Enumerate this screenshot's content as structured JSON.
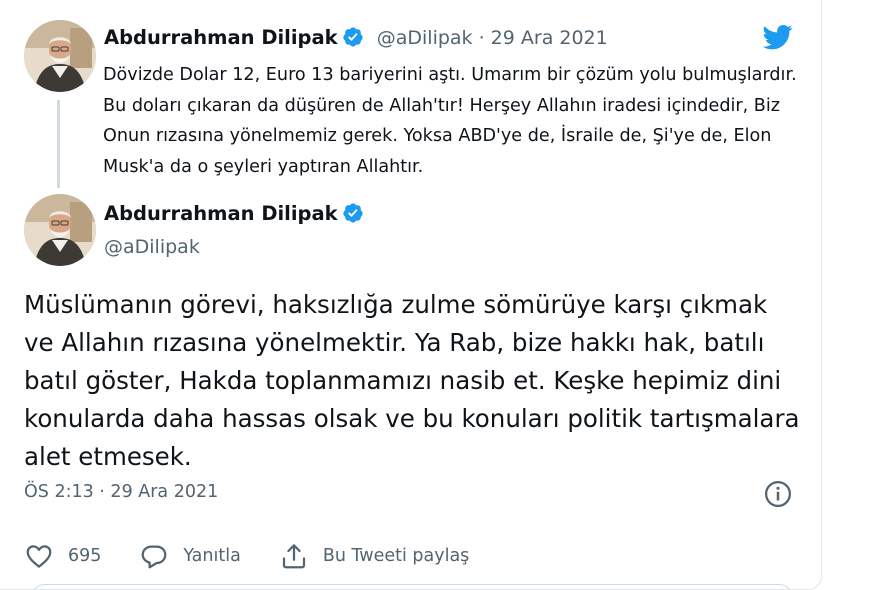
{
  "quoted_tweet": {
    "author_name": "Abdurrahman Dilipak",
    "handle_date": "@aDilipak · 29 Ara 2021",
    "text": "Dövizde Dolar 12, Euro 13 bariyerini aştı. Umarım bir çözüm yolu bulmuşlardır. Bu doları çıkaran da düşüren de Allah'tır! Herşey Allahın iradesi içindedir, Biz Onun rızasına yönelmemiz gerek. Yoksa ABD'ye de, İsraile de, Şi'ye de, Elon Musk'a da o şeyleri yaptıran Allahtır."
  },
  "main_tweet": {
    "author_name": "Abdurrahman Dilipak",
    "handle": "@aDilipak",
    "text": "Müslümanın görevi, haksızlığa zulme sömürüye karşı çıkmak ve Allahın rızasına yönelmektir. Ya Rab, bize hakkı hak, batılı batıl göster, Hakda toplanmamızı nasib et. Keşke hepimiz dini konularda daha hassas olsak ve bu konuları politik tartışmalara alet etmesek.",
    "timestamp": "ÖS 2:13 · 29 Ara 2021"
  },
  "actions": {
    "like_count": "695",
    "reply_label": "Yanıtla",
    "share_label": "Bu Tweeti paylaş"
  },
  "icons": {
    "logo": "twitter-bird-icon",
    "verified": "verified-badge-icon",
    "info": "info-icon",
    "like": "heart-icon",
    "reply": "reply-bubble-icon",
    "share": "share-icon"
  },
  "colors": {
    "brand": "#1d9bf0",
    "text": "#0f1419",
    "secondary": "#536471",
    "thread_line": "#cfd9de"
  }
}
